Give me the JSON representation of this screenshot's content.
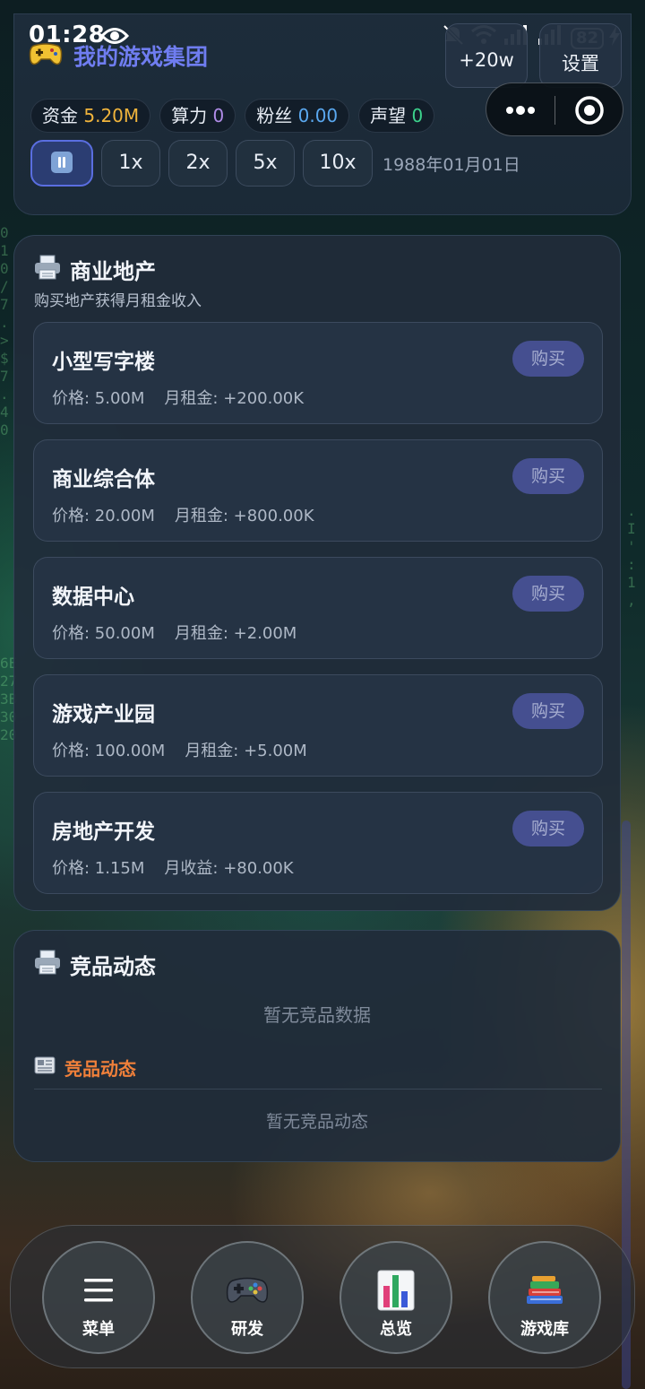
{
  "statusbar": {
    "time": "01:28",
    "battery": "82"
  },
  "header": {
    "title": "我的游戏集团",
    "buttons": {
      "bonus": "+20w",
      "settings": "设置"
    },
    "stats": [
      {
        "label": "资金",
        "value": "5.20M",
        "color": "#f0b43c"
      },
      {
        "label": "算力",
        "value": "0",
        "color": "#b08ce8"
      },
      {
        "label": "粉丝",
        "value": "0.00",
        "color": "#5aa8f0"
      },
      {
        "label": "声望",
        "value": "0",
        "color": "#3cd28c"
      }
    ],
    "speeds": [
      "1x",
      "2x",
      "5x",
      "10x"
    ],
    "date": "1988年01月01日"
  },
  "real_estate": {
    "title": "商业地产",
    "subtitle": "购买地产获得月租金收入",
    "items": [
      {
        "name": "小型写字楼",
        "price": "价格: 5.00M",
        "income": "月租金: +200.00K",
        "button": "购买"
      },
      {
        "name": "商业综合体",
        "price": "价格: 20.00M",
        "income": "月租金: +800.00K",
        "button": "购买"
      },
      {
        "name": "数据中心",
        "price": "价格: 50.00M",
        "income": "月租金: +2.00M",
        "button": "购买"
      },
      {
        "name": "游戏产业园",
        "price": "价格: 100.00M",
        "income": "月租金: +5.00M",
        "button": "购买"
      },
      {
        "name": "房地产开发",
        "price": "价格: 1.15M",
        "income": "月收益: +80.00K",
        "button": "购买"
      }
    ]
  },
  "competitors": {
    "title": "竞品动态",
    "empty_data": "暂无竞品数据",
    "section_title": "竞品动态",
    "empty_news": "暂无竞品动态"
  },
  "nav": [
    {
      "label": "菜单",
      "icon": "menu-icon"
    },
    {
      "label": "研发",
      "icon": "gamepad-icon"
    },
    {
      "label": "总览",
      "icon": "bar-chart-icon"
    },
    {
      "label": "游戏库",
      "icon": "books-icon"
    }
  ]
}
